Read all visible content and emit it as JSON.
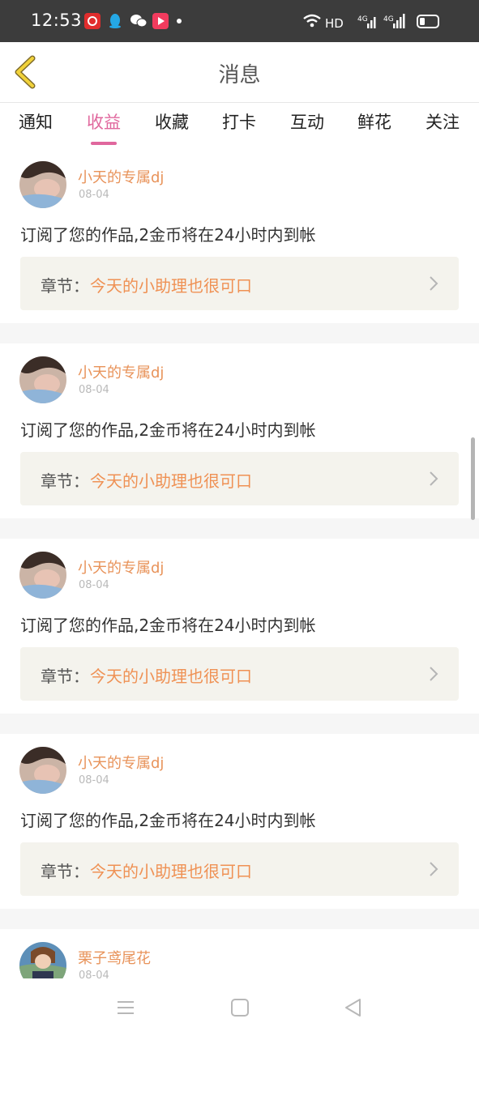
{
  "status_bar": {
    "time": "12:53",
    "network": "HD",
    "signal1": "4G",
    "signal2": "4G",
    "icons": [
      "app-icon-red",
      "qq-icon",
      "wechat-icon",
      "video-app-icon",
      "dot-icon",
      "wifi-icon",
      "battery-icon"
    ]
  },
  "header": {
    "title": "消息",
    "back_icon": "chevron-left-icon"
  },
  "tabs": [
    {
      "label": "通知",
      "active": false
    },
    {
      "label": "收益",
      "active": true
    },
    {
      "label": "收藏",
      "active": false
    },
    {
      "label": "打卡",
      "active": false
    },
    {
      "label": "互动",
      "active": false
    },
    {
      "label": "鲜花",
      "active": false
    },
    {
      "label": "关注",
      "active": false
    }
  ],
  "messages": [
    {
      "name": "小天的专属dj",
      "date": "08-04",
      "text": "订阅了您的作品,2金币将在24小时内到帐",
      "chapter_label": "章节：",
      "chapter_title": "今天的小助理也很可口"
    },
    {
      "name": "小天的专属dj",
      "date": "08-04",
      "text": "订阅了您的作品,2金币将在24小时内到帐",
      "chapter_label": "章节：",
      "chapter_title": "今天的小助理也很可口"
    },
    {
      "name": "小天的专属dj",
      "date": "08-04",
      "text": "订阅了您的作品,2金币将在24小时内到帐",
      "chapter_label": "章节：",
      "chapter_title": "今天的小助理也很可口"
    },
    {
      "name": "小天的专属dj",
      "date": "08-04",
      "text": "订阅了您的作品,2金币将在24小时内到帐",
      "chapter_label": "章节：",
      "chapter_title": "今天的小助理也很可口"
    },
    {
      "name": "栗子鸢尾花",
      "date": "08-04"
    }
  ],
  "nav_bar": {
    "icons": [
      "menu-icon",
      "home-icon",
      "back-icon"
    ]
  },
  "colors": {
    "accent_pink": "#e0679d",
    "name_orange": "#e8935a",
    "chapter_orange": "#ef9154",
    "chapter_bg": "#f4f3ed",
    "status_bar_bg": "#3c3c3c"
  }
}
